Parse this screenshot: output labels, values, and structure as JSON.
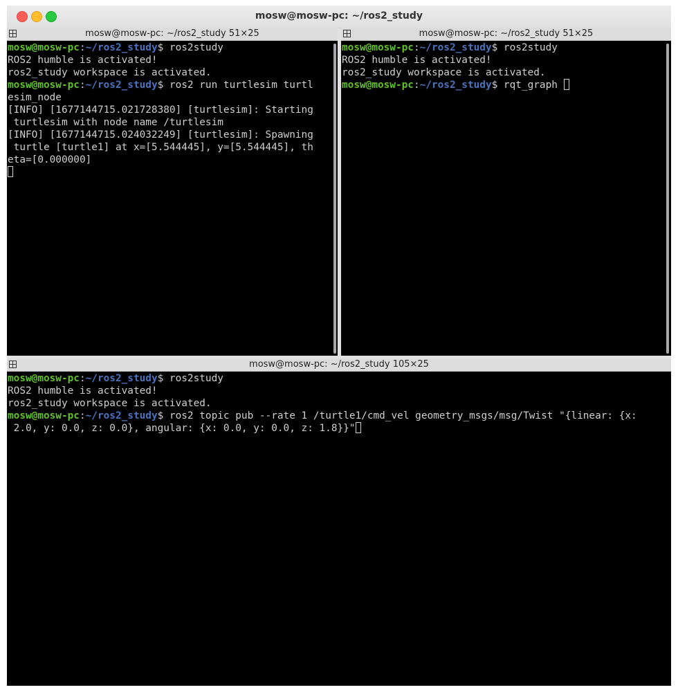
{
  "window": {
    "title": "mosw@mosw-pc: ~/ros2_study"
  },
  "panes": {
    "left": {
      "title": "mosw@mosw-pc: ~/ros2_study 51×25",
      "lines": [
        {
          "user": "mosw@mosw-pc",
          "colon": ":",
          "path": "~/ros2_study",
          "cmd": "$ ros2study"
        },
        {
          "text": "ROS2 humble is activated!"
        },
        {
          "text": "ros2_study workspace is activated."
        },
        {
          "user": "mosw@mosw-pc",
          "colon": ":",
          "path": "~/ros2_study",
          "cmd": "$ ros2 run turtlesim turtl"
        },
        {
          "text": "esim_node"
        },
        {
          "text": "[INFO] [1677144715.021728380] [turtlesim]: Starting"
        },
        {
          "text": " turtlesim with node name /turtlesim"
        },
        {
          "text": "[INFO] [1677144715.024032249] [turtlesim]: Spawning"
        },
        {
          "text": " turtle [turtle1] at x=[5.544445], y=[5.544445], th"
        },
        {
          "text": "eta=[0.000000]"
        }
      ]
    },
    "right": {
      "title": "mosw@mosw-pc: ~/ros2_study 51×25",
      "lines": [
        {
          "user": "mosw@mosw-pc",
          "colon": ":",
          "path": "~/ros2_study",
          "cmd": "$ ros2study"
        },
        {
          "text": "ROS2 humble is activated!"
        },
        {
          "text": "ros2_study workspace is activated."
        },
        {
          "user": "mosw@mosw-pc",
          "colon": ":",
          "path": "~/ros2_study",
          "cmd": "$ rqt_graph "
        }
      ]
    },
    "bottom": {
      "title": "mosw@mosw-pc: ~/ros2_study 105×25",
      "lines": [
        {
          "user": "mosw@mosw-pc",
          "colon": ":",
          "path": "~/ros2_study",
          "cmd": "$ ros2study"
        },
        {
          "text": "ROS2 humble is activated!"
        },
        {
          "text": "ros2_study workspace is activated."
        },
        {
          "user": "mosw@mosw-pc",
          "colon": ":",
          "path": "~/ros2_study",
          "cmd": "$ ros2 topic pub --rate 1 /turtle1/cmd_vel geometry_msgs/msg/Twist \"{linear: {x:"
        },
        {
          "text": " 2.0, y: 0.0, z: 0.0}, angular: {x: 0.0, y: 0.0, z: 1.8}}\""
        }
      ]
    }
  },
  "icons": {
    "pane_split": "split-pane-icon",
    "close": "close-window-icon",
    "minimize": "minimize-window-icon",
    "maximize": "maximize-window-icon"
  },
  "colors": {
    "prompt_user": "#5fc326",
    "prompt_path": "#4a73bf",
    "terminal_bg": "#000000",
    "terminal_fg": "#cfcfcf"
  }
}
